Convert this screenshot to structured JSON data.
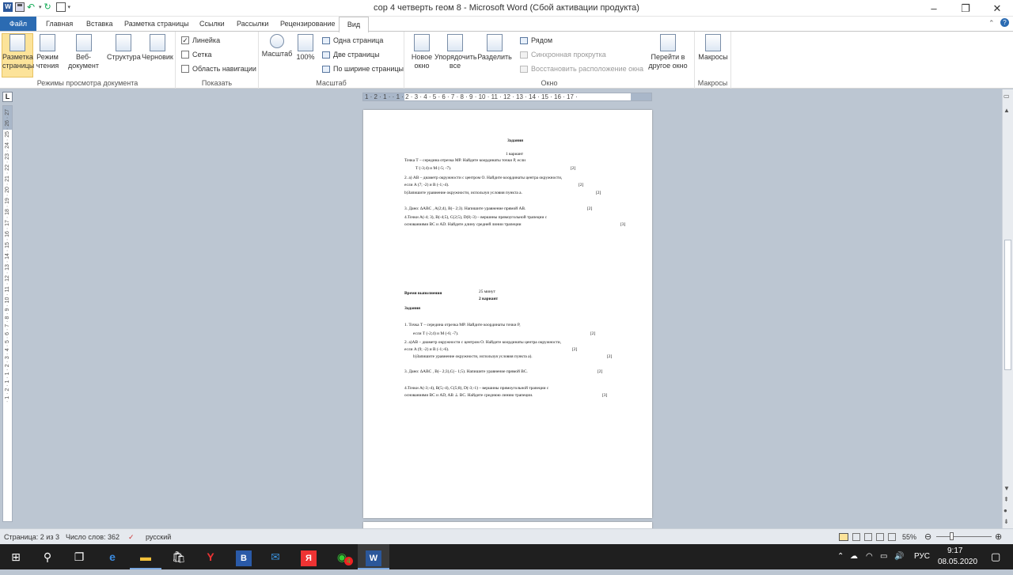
{
  "window": {
    "title": "сор 4 четверть геом 8  -  Microsoft Word (Сбой активации продукта)"
  },
  "tabs": [
    "Файл",
    "Главная",
    "Вставка",
    "Разметка страницы",
    "Ссылки",
    "Рассылки",
    "Рецензирование",
    "Вид"
  ],
  "ribbon": {
    "views": {
      "print": "Разметка страницы",
      "read": "Режим чтения",
      "web": "Веб-документ",
      "outline": "Структура",
      "draft": "Черновик",
      "label": "Режимы просмотра документа"
    },
    "show": {
      "ruler": "Линейка",
      "grid": "Сетка",
      "nav": "Область навигации",
      "label": "Показать"
    },
    "zoom": {
      "zoom": "Масштаб",
      "hundred": "100%",
      "one_page": "Одна страница",
      "two_pages": "Две страницы",
      "page_width": "По ширине страницы",
      "label": "Масштаб"
    },
    "window": {
      "new": "Новое окно",
      "arrange": "Упорядочить все",
      "split": "Разделить",
      "side": "Рядом",
      "sync": "Синхронная прокрутка",
      "reset": "Восстановить расположение окна",
      "switch": "Перейти в другое окно",
      "label": "Окно"
    },
    "macros": {
      "macros": "Макросы",
      "label": "Макросы"
    }
  },
  "ruler": {
    "h_ticks": "1 · 2 · 1 · · 1 · 2 · 3 · 4 · 5 · 6 · 7 · 8 · 9 · 10 · 11 · 12 · 13 · 14 · 15 · 16 · 17 ·",
    "v_ticks": "· 1 · 2 · 1 · 1 · 2 · 3 · 4 · 5 · 6 · 7 · 8 · 9 · 10 · 11 · 12 · 13 · 14 · 15 · 16 · 17 · 18 · 19 · 20 · 21 · 22 · 23 · 24 · 25 · 26 · 27"
  },
  "doc": {
    "l1": "Задания",
    "l2": "1 вариант",
    "l3": "Точка Т – середина отрезка MP. Найдите координаты точки P, если",
    "l4": "T (-3;4) и M (-5; -7).",
    "l4s": "[2]",
    "l5": "2. а)  AB  – диаметр окружности с центром O. Найдите координаты центра окружности,",
    "l6": "если    A (7; -2) и B (-1;-4).",
    "l6s": "[2]",
    "l7": "b)Запишите уравнение окружности, используя условия пункта a.",
    "l7s": "[2]",
    "l8": "3. Дано:  ∆ABC ,  A(2;4), B(– 2;3).  Напишите уравнение прямой AB.",
    "l8s": "[2]",
    "l9": "4.Точки A(-4; 3), B(-4;5), C(2;5), D(8;-3) – вершины прямоугольной трапеции с",
    "l10": "основаниями BC и AD. Найдите  длину средней линии трапеции",
    "l10s": "[3]",
    "m1": "Время выполнения",
    "m1v": "25 минут",
    "m2": "2 вариант",
    "m3": "Задания",
    "m4": "1.    Точка Т – середина отрезка MP. Найдите координаты точки P,",
    "m5": "если Т (-2;4) и M (-6; -7).",
    "m5s": "[2]",
    "m6": "2.      a)AB – диаметр окружности с центром O. Найдите координаты центра окружности,",
    "m7": "если    A (9; -2) и B (-1;-6).",
    "m7s": "[2]",
    "m8": "b)Запишите уравнение окружности, используя условия пункта a).",
    "m8s": "[2]",
    "m9": "3. Дано:  ∆ABC ,  B(– 2;3),C(– 1;5).  Напишите уравнение прямой BC.",
    "m9s": "[2]",
    "m10": "4.Точки A(-3;-4), B(5;-4), C(5;8), D(-3;-1) – вершины прямоугольной трапеции с",
    "m11": "основаниями BC и AD, AB ⊥ BC. Найдите   среднюю линию трапеции.",
    "m11s": "[3]"
  },
  "status": {
    "page": "Страница: 2 из 3",
    "words": "Число слов: 362",
    "lang": "русский",
    "zoom": "55%"
  },
  "taskbar": {
    "lang": "РУС",
    "time": "9:17",
    "date": "08.05.2020",
    "whatsapp_badge": "4"
  }
}
